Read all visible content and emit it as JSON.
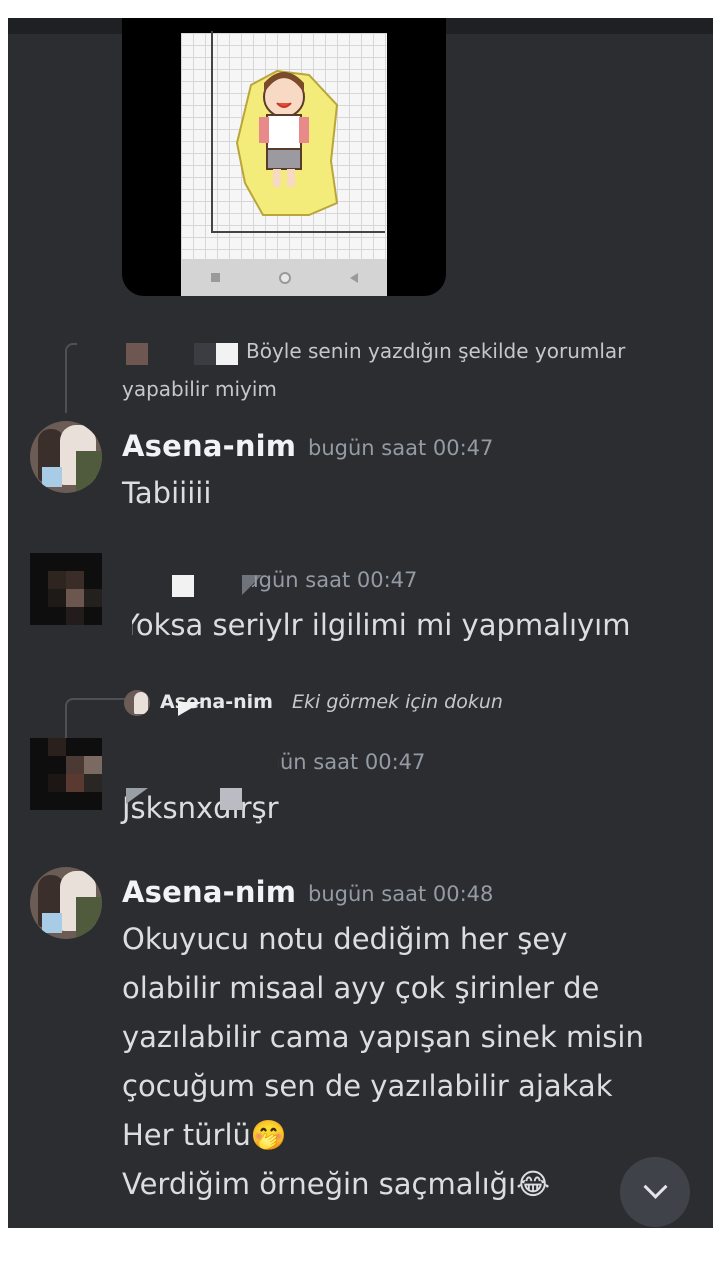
{
  "messages": [
    {
      "reply_preview": "Böyle senin yazdığın şekilde yorumlar",
      "reply_preview_cont": "yapabilir miyim"
    },
    {
      "author": "Asena-nim",
      "timestamp": "bugün saat 00:47",
      "text": "Tabiiiii"
    },
    {
      "timestamp": "bugün saat 00:47",
      "text": "Yoksa seriylr ilgilimi mi yapmalıyım"
    },
    {
      "reply_author": "Asena-nim",
      "reply_hint": "Eki görmek için dokun",
      "timestamp": "bugün saat 00:47",
      "text": "Jsksnxdırşr"
    },
    {
      "author": "Asena-nim",
      "timestamp": "bugün saat 00:48",
      "lines": [
        "Okuyucu notu dediğim her şey",
        "olabilir misaal ayy çok şirinler de",
        "yazılabilir cama yapışan sinek misin",
        "çocuğum sen de yazılabilir ajakak",
        "Her türlü🤭",
        "Verdiğim örneğin saçmalığı😂"
      ]
    }
  ],
  "icons": {
    "scroll_to_bottom": "chevron-down-icon"
  },
  "colors": {
    "background": "#2b2d31",
    "text": "#dbdee1",
    "timestamp": "#949ba4",
    "scroll_button": "#404249"
  }
}
